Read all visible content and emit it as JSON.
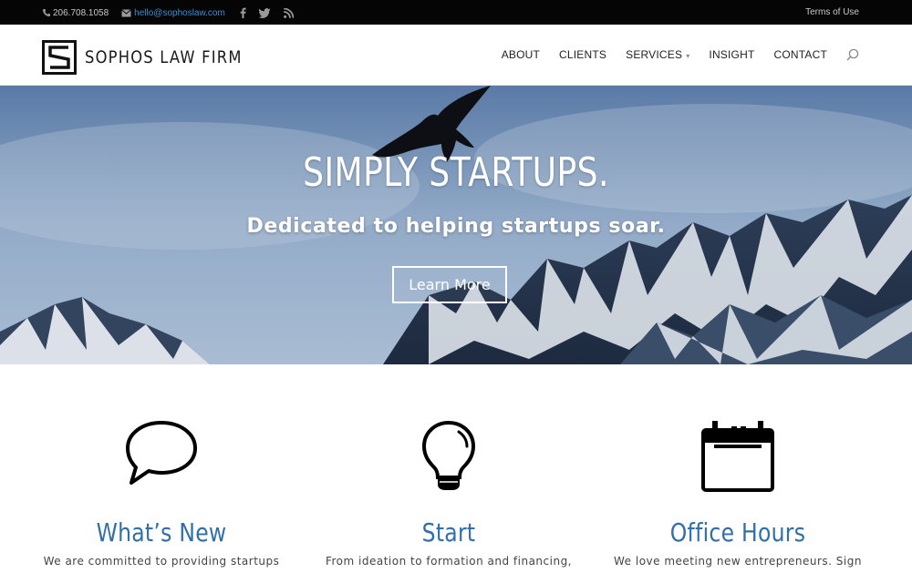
{
  "topbar": {
    "phone": "206.708.1058",
    "email": "hello@sophoslaw.com",
    "social_icons": [
      "facebook-icon",
      "twitter-icon",
      "rss-icon"
    ],
    "terms_link": "Terms of Use"
  },
  "header": {
    "logo_text": "SOPHOS LAW FIRM",
    "nav": [
      {
        "label": "ABOUT"
      },
      {
        "label": "CLIENTS"
      },
      {
        "label": "SERVICES",
        "has_dropdown": true
      },
      {
        "label": "INSIGHT"
      },
      {
        "label": "CONTACT"
      }
    ],
    "search_icon": "search-icon"
  },
  "hero": {
    "title": "SIMPLY STARTUPS.",
    "subtitle": "Dedicated to helping startups soar.",
    "button_label": "Learn More"
  },
  "features": [
    {
      "icon": "speech-bubble-icon",
      "title": "What’s New",
      "text": "We are committed to providing startups"
    },
    {
      "icon": "lightbulb-icon",
      "title": "Start",
      "text": "From ideation to formation and financing,"
    },
    {
      "icon": "calendar-icon",
      "title": "Office Hours",
      "text": "We love meeting new entrepreneurs.  Sign"
    }
  ],
  "colors": {
    "topbar_bg": "#050505",
    "email_link": "#3a8fd6",
    "feature_title": "#2f6fab",
    "hero_sky": "#8aa3c3"
  }
}
